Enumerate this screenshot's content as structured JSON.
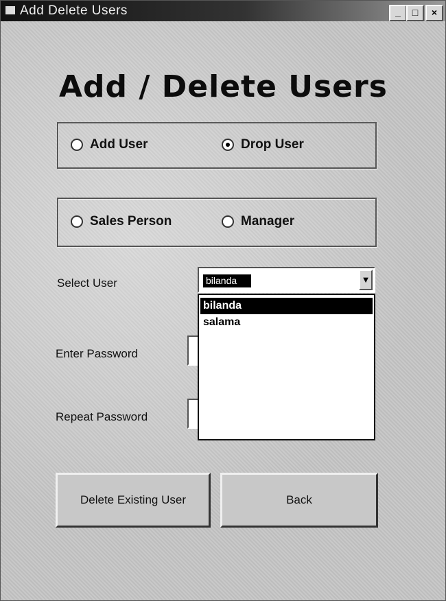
{
  "window": {
    "title": "Add Delete Users"
  },
  "titlebar_buttons": {
    "minimize": "_",
    "maximize": "□",
    "close": "×"
  },
  "heading": "Add / Delete Users",
  "action_group": {
    "add_user": {
      "label": "Add User",
      "checked": false
    },
    "drop_user": {
      "label": "Drop User",
      "checked": true
    }
  },
  "role_group": {
    "sales_person": {
      "label": "Sales Person",
      "checked": false
    },
    "manager": {
      "label": "Manager",
      "checked": false
    }
  },
  "form": {
    "select_user_label": "Select User",
    "enter_password_label": "Enter Password",
    "repeat_password_label": "Repeat Password"
  },
  "user_combo": {
    "selected": "bilanda",
    "options": [
      "bilanda",
      "salama"
    ]
  },
  "buttons": {
    "delete": "Delete Existing User",
    "back": "Back"
  }
}
